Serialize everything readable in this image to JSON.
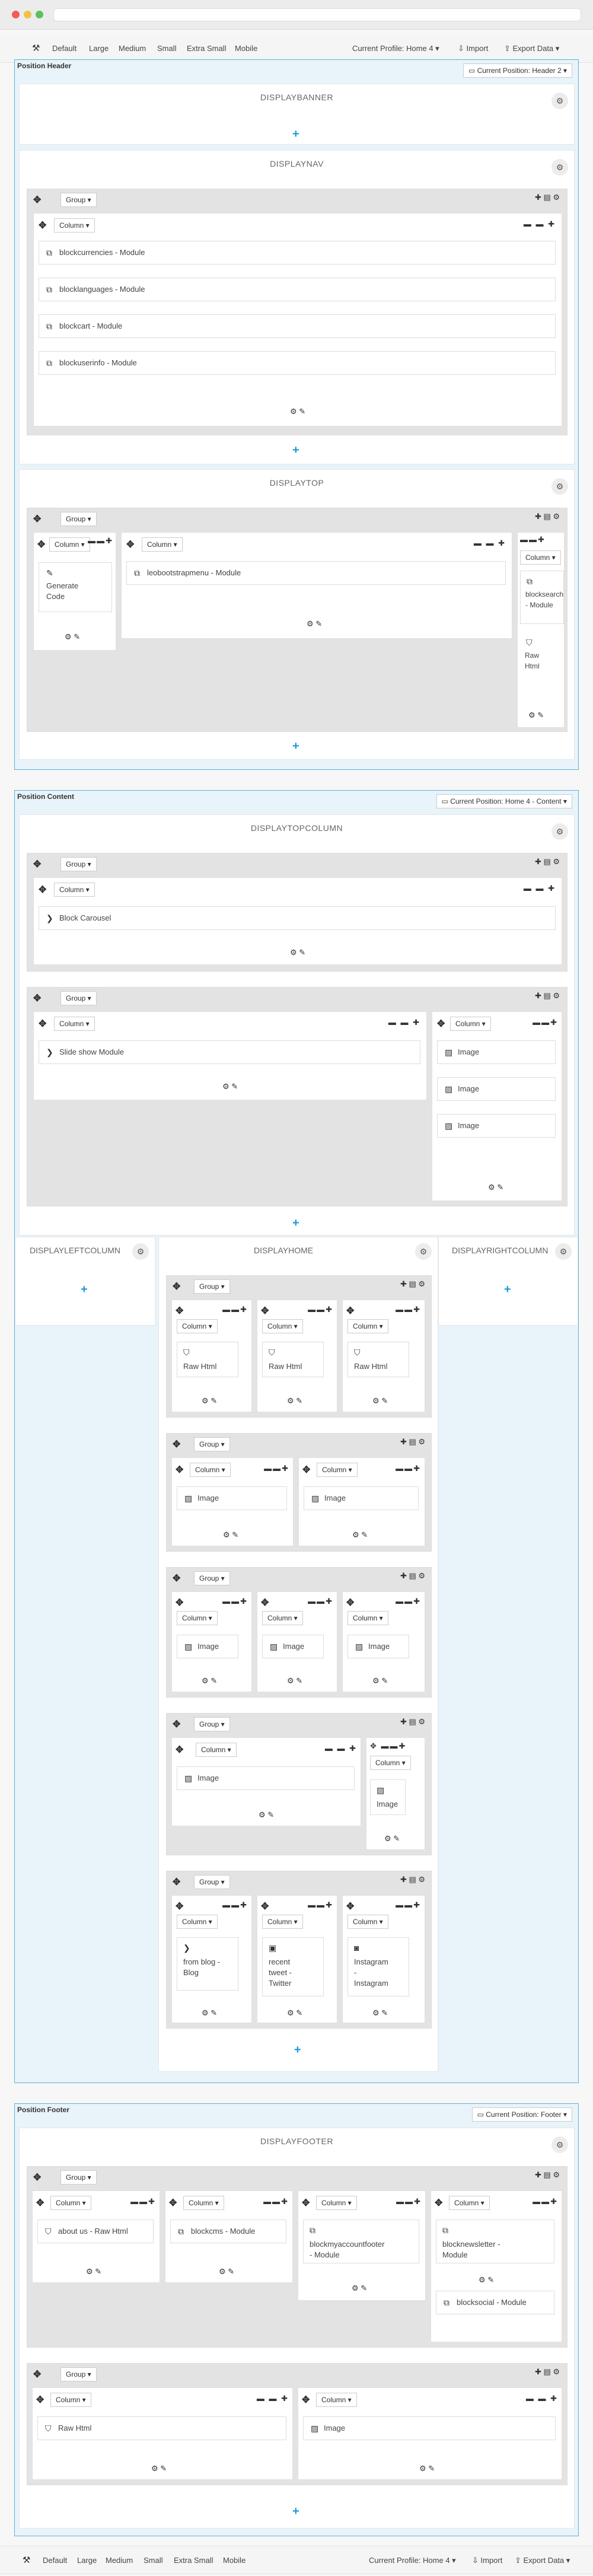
{
  "toolbar": {
    "devices": [
      "Default",
      "Large",
      "Medium",
      "Small",
      "Extra Small",
      "Mobile"
    ],
    "profile": "Current Profile: Home 4 ▾",
    "import": "Import",
    "export": "Export Data ▾"
  },
  "labels": {
    "group": "Group ▾",
    "column": "Column ▾"
  },
  "header": {
    "title": "Position Header",
    "current": "Current Position: Header 2 ▾",
    "banner": "DISPLAYBANNER",
    "nav": "DISPLAYNAV",
    "nav_modules": [
      "blockcurrencies - Module",
      "blocklanguages - Module",
      "blockcart - Module",
      "blockuserinfo - Module"
    ],
    "top": "DISPLAYTOP",
    "top_mod1": [
      "Generate",
      "Code"
    ],
    "top_mod2": "leobootstrapmenu - Module",
    "top_mod3": [
      "blocksearch",
      "- Module"
    ],
    "top_mod4": [
      "Raw",
      "Html"
    ]
  },
  "content": {
    "title": "Position Content",
    "current": "Current Position: Home 4 - Content ▾",
    "topcolumn": "DISPLAYTOPCOLUMN",
    "carousel": "Block Carousel",
    "slideshow": "Slide show Module",
    "image": "Image",
    "left": "DISPLAYLEFTCOLUMN",
    "home": "DISPLAYHOME",
    "right": "DISPLAYRIGHTCOLUMN",
    "rawhtml": "Raw Html",
    "blog": [
      "from blog -",
      "Blog"
    ],
    "twitter": [
      "recent",
      "tweet -",
      "Twitter"
    ],
    "instagram": [
      "Instagram",
      "-",
      "Instagram"
    ]
  },
  "footer": {
    "title": "Position Footer",
    "current": "Current Position: Footer ▾",
    "hook": "DISPLAYFOOTER",
    "mods": [
      "about us - Raw Html",
      "blockcms - Module"
    ],
    "myaccount": [
      "blockmyaccountfooter",
      "- Module"
    ],
    "newsletter": [
      "blocknewsletter -",
      "Module"
    ],
    "social": "blocksocial - Module",
    "rawhtml": "Raw Html",
    "image": "Image"
  },
  "colors": {
    "accent": "#1d9bd6",
    "position_border": "#5fb0d8",
    "position_bg": "#e8f3fa"
  }
}
